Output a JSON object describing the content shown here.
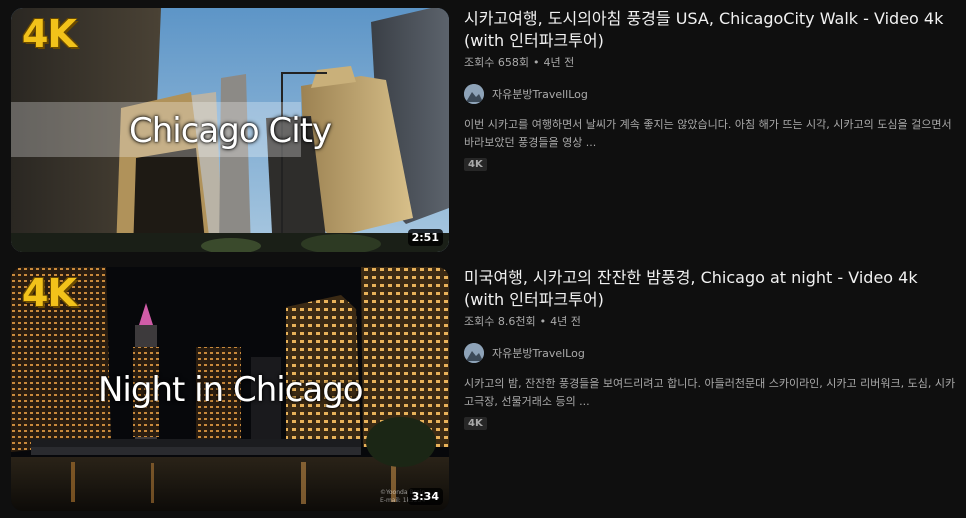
{
  "videos": [
    {
      "badge": "4K",
      "overlay_text": "Chicago City",
      "duration": "2:51",
      "title_line1": "시카고여행, 도시의아침 풍경들 USA, ChicagoCity Walk - Video 4k",
      "title_line2": "(with 인터파크투어)",
      "views": "조회수 658회",
      "age": "4년 전",
      "channel": "자유분방TravellLog",
      "description_line1": "이번 시카고를 여행하면서 날씨가 계속 좋지는 않았습니다. 아침 해가 뜨는 시각, 시카고의 도심을 걸으면서",
      "description_line2": "바라보았던 풍경들을 영상 ...",
      "tag": "4K"
    },
    {
      "badge": "4K",
      "overlay_text": "Night in Chicago",
      "duration": "3:34",
      "watermark_line1": "©Yoonda Brain",
      "watermark_line2": "E-mail: 1k5234",
      "title_line1": "미국여행, 시카고의 잔잔한 밤풍경, Chicago at night - Video 4k",
      "title_line2": "(with 인터파크투어)",
      "views": "조회수 8.6천회",
      "age": "4년 전",
      "channel": "자유분방TravelLog",
      "description_line1": "시카고의 밤, 잔잔한 풍경들을 보여드리려고 합니다. 아들러천문대 스카이라인, 시카고 리버워크, 도심, 시카",
      "description_line2": "고극장, 선물거래소 등의 ...",
      "tag": "4K"
    }
  ],
  "colors": {
    "background": "#0f0f0f",
    "title": "#f1f1f1",
    "meta": "#aaaaaa",
    "badge_yellow": "#f2c21a",
    "tag_bg": "#272727"
  }
}
